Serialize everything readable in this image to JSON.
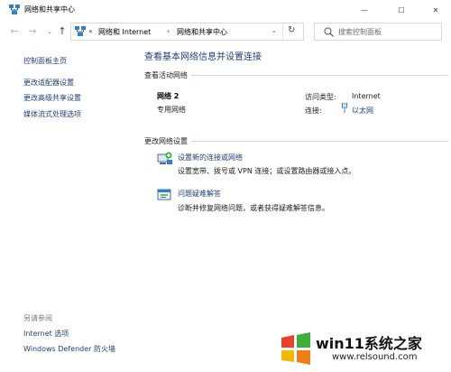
{
  "window": {
    "title": "网络和共享中心",
    "minimize_glyph": "—",
    "maximize_glyph": "☐",
    "close_glyph": "✕"
  },
  "nav": {
    "back_glyph": "←",
    "forward_glyph": "→",
    "recent_glyph": "⌄",
    "up_glyph": "↑"
  },
  "address": {
    "separator": "«",
    "crumbs": [
      "网络和 Internet",
      "网络和共享中心"
    ],
    "crumb_arrow": "›",
    "dropdown_glyph": "⌄",
    "refresh_glyph": "↻"
  },
  "search": {
    "placeholder": "搜索控制面板"
  },
  "sidebar": {
    "home": "控制面板主页",
    "items": [
      "更改适配器设置",
      "更改高级共享设置",
      "媒体流式处理选项"
    ],
    "see_also_title": "另请参阅",
    "see_also": [
      "Internet 选项",
      "Windows Defender 防火墙"
    ]
  },
  "main": {
    "title": "查看基本网络信息并设置连接",
    "active_networks_label": "查看活动网络",
    "network": {
      "name": "网络 2",
      "type": "专用网络",
      "access_type_label": "访问类型:",
      "access_type_value": "Internet",
      "connections_label": "连接:",
      "connections_value": "以太网"
    },
    "change_settings_label": "更改网络设置",
    "tasks": [
      {
        "link": "设置新的连接或网络",
        "desc": "设置宽带、拨号或 VPN 连接；或设置路由器或接入点。"
      },
      {
        "link": "问题疑难解答",
        "desc": "诊断并修复网络问题，或者获得疑难解答信息。"
      }
    ]
  },
  "watermark": {
    "brand": "win11系统之家",
    "url": "www.relsound.com",
    "colors": {
      "red": "#e8412c",
      "green": "#3fae3a",
      "yellow": "#f5b800",
      "orange": "#f07d16"
    }
  },
  "colors": {
    "link": "#1f3f7a",
    "title": "#1e3f7a",
    "divider": "#cfd8e3"
  }
}
